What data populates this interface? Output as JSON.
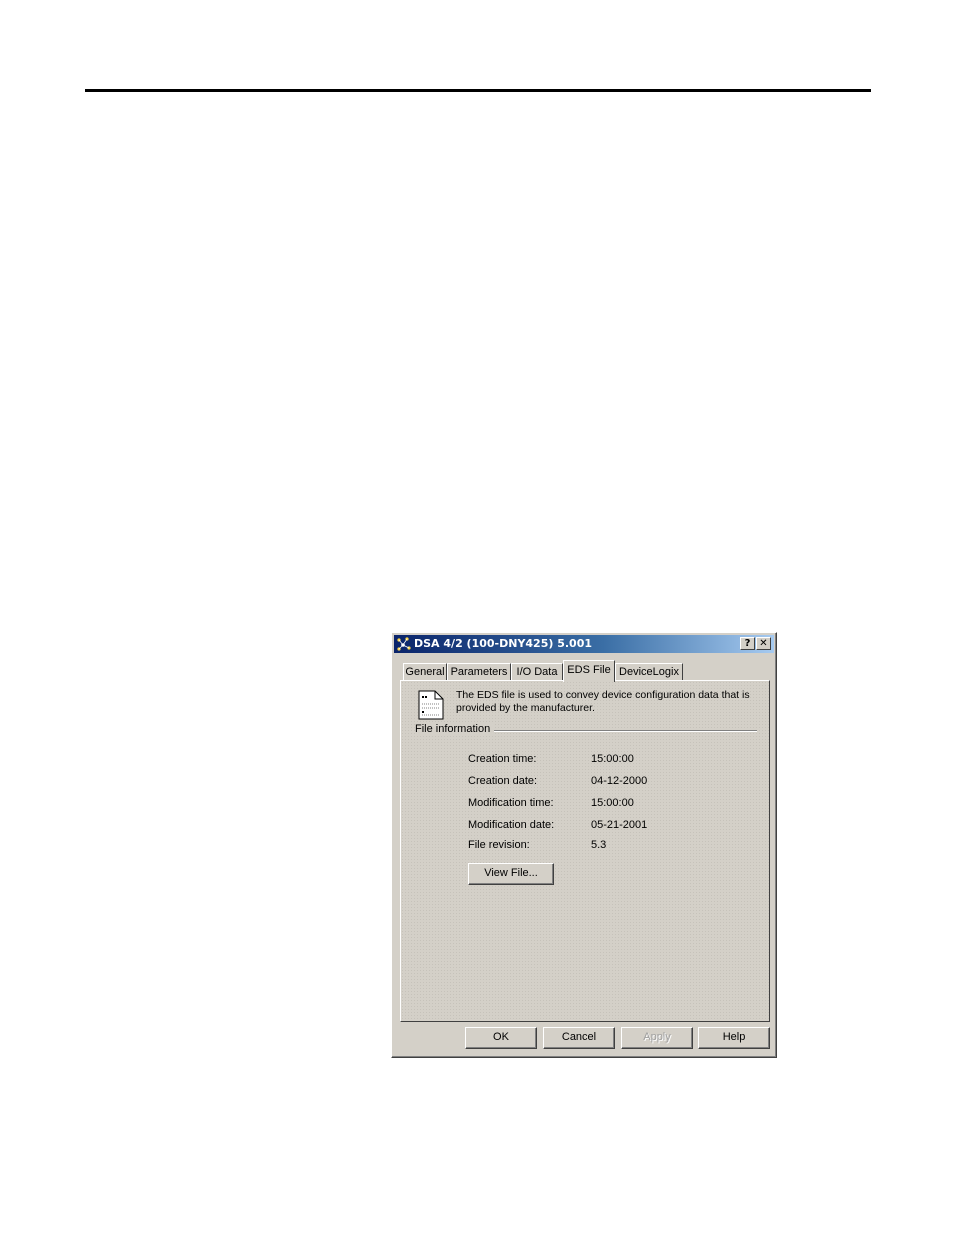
{
  "window": {
    "title": "DSA 4/2 (100-DNY425) 5.001",
    "help_glyph": "?",
    "close_glyph": "✕"
  },
  "tabs": [
    "General",
    "Parameters",
    "I/O Data",
    "EDS File",
    "DeviceLogix"
  ],
  "active_tab": "EDS File",
  "description": "The EDS file is used to convey device configuration data that is provided by the manufacturer.",
  "file_info": {
    "group_label": "File information",
    "rows": [
      {
        "label": "Creation time:",
        "value": "15:00:00"
      },
      {
        "label": "Creation date:",
        "value": "04-12-2000"
      },
      {
        "label": "Modification time:",
        "value": "15:00:00"
      },
      {
        "label": "Modification date:",
        "value": "05-21-2001"
      },
      {
        "label": "File revision:",
        "value": "5.3"
      }
    ],
    "view_button": "View File..."
  },
  "buttons": {
    "ok": "OK",
    "cancel": "Cancel",
    "apply": "Apply",
    "help": "Help"
  }
}
